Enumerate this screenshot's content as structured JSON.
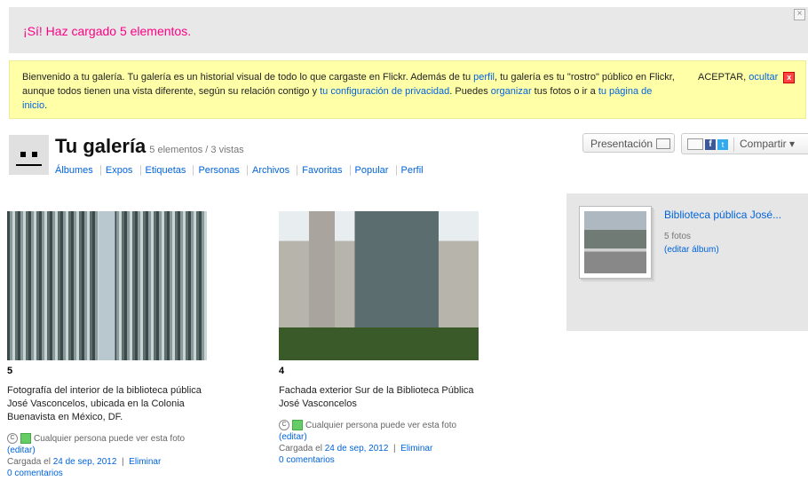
{
  "success": {
    "message": "¡Sí! Haz cargado 5 elementos.",
    "close_glyph": "×"
  },
  "notice": {
    "text_1": "Bienvenido a tu galería. Tu galería es un historial visual de todo lo que cargaste en Flickr. Además de tu ",
    "link_perfil": "perfil",
    "text_2": ", tu galería es tu \"rostro\" público en Flickr, aunque todos tienen una vista diferente, según su relación contigo y ",
    "link_privacidad": "tu configuración de privacidad",
    "text_3": ". Puedes ",
    "link_organizar": "organizar",
    "text_4": " tus fotos o ir a ",
    "link_inicio": "tu página de inicio",
    "text_5": ".",
    "accept": "ACEPTAR, ",
    "hide": "ocultar",
    "close_glyph": "x"
  },
  "header": {
    "title": "Tu galería",
    "stats": "5 elementos / 3 vistas",
    "nav": [
      "Álbumes",
      "Expos",
      "Etiquetas",
      "Personas",
      "Archivos",
      "Favoritas",
      "Popular",
      "Perfil"
    ],
    "presentation_label": "Presentación",
    "share_label": "Compartir ▾",
    "fb_glyph": "f",
    "tw_glyph": "t"
  },
  "photos": [
    {
      "number": "5",
      "description": "Fotografía del interior de la biblioteca pública José Vasconcelos, ubicada en la Colonia Buenavista en México, DF.",
      "privacy": "Cualquier persona puede ver esta foto",
      "edit": "(editar)",
      "uploaded_prefix": "Cargada el ",
      "date": "24 de sep, 2012",
      "delete": "Eliminar",
      "comments": "0 comentarios"
    },
    {
      "number": "4",
      "description": "Fachada exterior Sur de la Biblioteca Pública José Vasconcelos",
      "privacy": "Cualquier persona puede ver esta foto",
      "edit": "(editar)",
      "uploaded_prefix": "Cargada el ",
      "date": "24 de sep, 2012",
      "delete": "Eliminar",
      "comments": "0 comentarios"
    }
  ],
  "album": {
    "title": "Biblioteca pública José...",
    "count": "5 fotos",
    "edit": "(editar álbum)"
  },
  "icons": {
    "cc": "cc-icon",
    "privacy": "privacy-icon",
    "monitor": "monitor-icon",
    "mail": "mail-icon",
    "facebook": "facebook-icon",
    "twitter": "twitter-icon"
  }
}
